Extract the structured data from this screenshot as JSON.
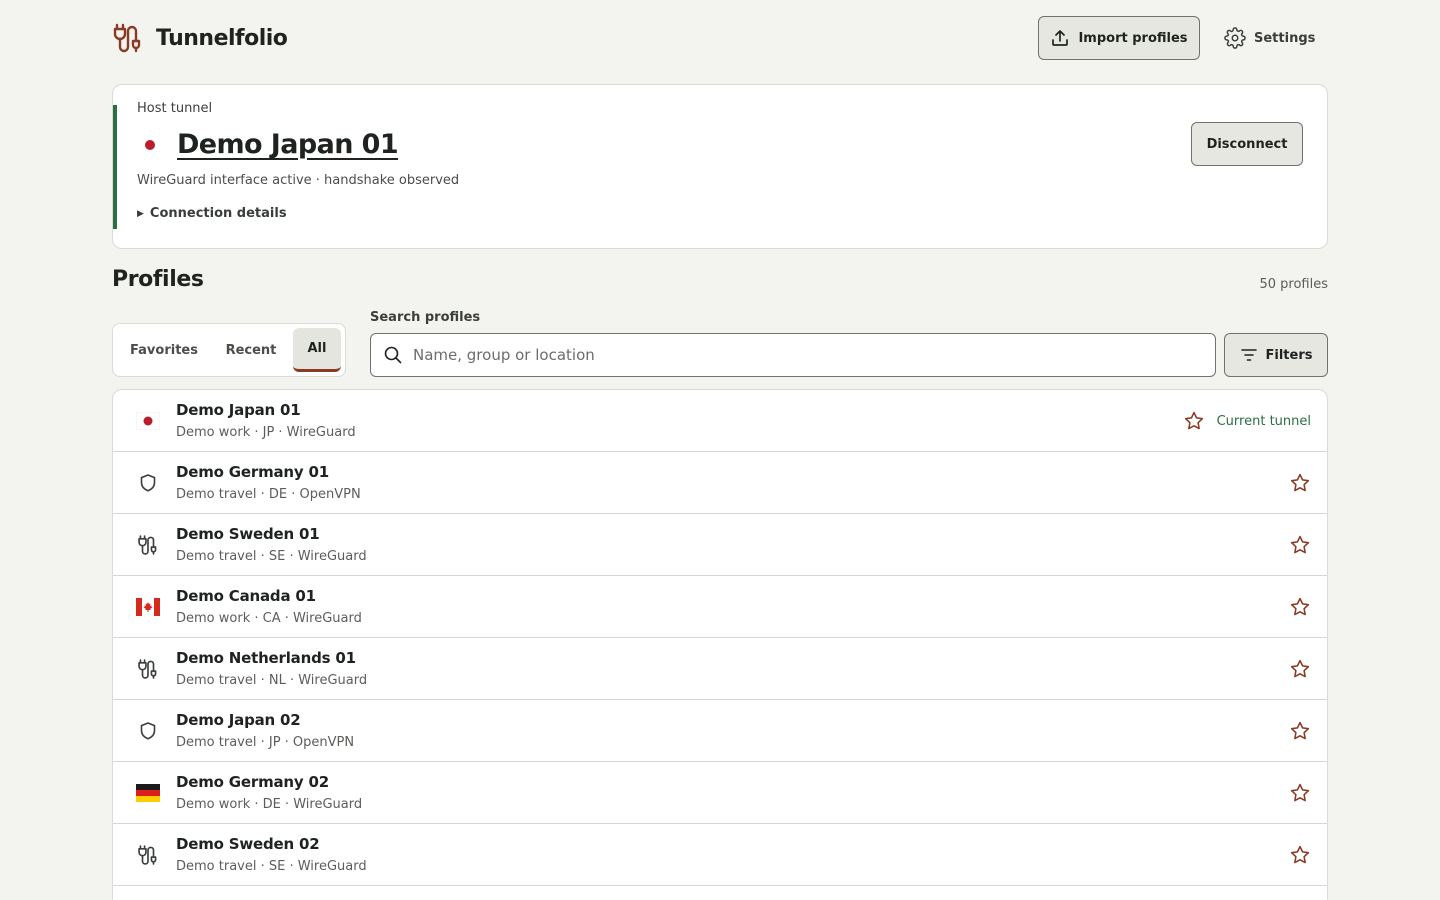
{
  "app": {
    "name": "Tunnelfolio",
    "import_label": "Import profiles",
    "settings_label": "Settings"
  },
  "host": {
    "label": "Host tunnel",
    "name": "Demo Japan 01",
    "flag": "jp",
    "status": "WireGuard interface active · handshake observed",
    "details_label": "Connection details",
    "disconnect_label": "Disconnect"
  },
  "profiles": {
    "title": "Profiles",
    "count": "50 profiles",
    "tabs": [
      {
        "label": "Favorites",
        "selected": false
      },
      {
        "label": "Recent",
        "selected": false
      },
      {
        "label": "All",
        "selected": true
      }
    ],
    "search": {
      "label": "Search profiles",
      "placeholder": "Name, group or location",
      "value": ""
    },
    "filters_label": "Filters",
    "current_label": "Current tunnel",
    "items": [
      {
        "name": "Demo Japan 01",
        "meta": "Demo work · JP · WireGuard",
        "icon": "flag-jp",
        "current": true
      },
      {
        "name": "Demo Germany 01",
        "meta": "Demo travel · DE · OpenVPN",
        "icon": "shield-icon",
        "current": false
      },
      {
        "name": "Demo Sweden 01",
        "meta": "Demo travel · SE · WireGuard",
        "icon": "tunnel-icon",
        "current": false
      },
      {
        "name": "Demo Canada 01",
        "meta": "Demo work · CA · WireGuard",
        "icon": "flag-ca",
        "current": false
      },
      {
        "name": "Demo Netherlands 01",
        "meta": "Demo travel · NL · WireGuard",
        "icon": "tunnel-icon",
        "current": false
      },
      {
        "name": "Demo Japan 02",
        "meta": "Demo travel · JP · OpenVPN",
        "icon": "shield-icon",
        "current": false
      },
      {
        "name": "Demo Germany 02",
        "meta": "Demo work · DE · WireGuard",
        "icon": "flag-de",
        "current": false
      },
      {
        "name": "Demo Sweden 02",
        "meta": "Demo travel · SE · WireGuard",
        "icon": "tunnel-icon",
        "current": false
      }
    ]
  },
  "colors": {
    "accent_green": "#2c6e43",
    "star_brown": "#8a3b24",
    "background": "#f3f3ef"
  }
}
